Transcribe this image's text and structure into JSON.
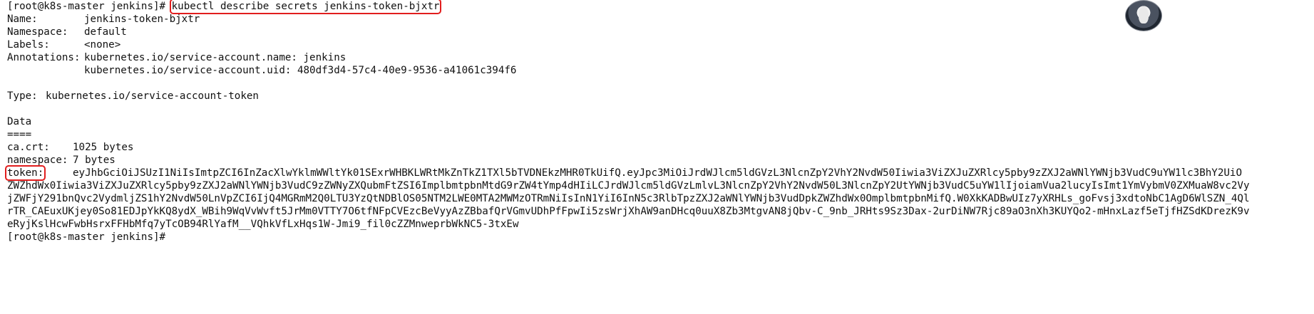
{
  "terminal": {
    "prompt": "[root@k8s-master jenkins]#",
    "command": "kubectl describe secrets jenkins-token-bjxtr",
    "name_label": "Name:",
    "name_value": "jenkins-token-bjxtr",
    "namespace_label": "Namespace:",
    "namespace_value": "default",
    "labels_label": "Labels:",
    "labels_value": "<none>",
    "annotations_label": "Annotations:",
    "annotation_1": "kubernetes.io/service-account.name: jenkins",
    "annotation_2": "kubernetes.io/service-account.uid: 480df3d4-57c4-40e9-9536-a41061c394f6",
    "type_label": "Type:",
    "type_value": "kubernetes.io/service-account-token",
    "data_header": "Data",
    "data_rule": "====",
    "cacrt_label": "ca.crt:",
    "cacrt_value": "1025 bytes",
    "ns_label": "namespace:",
    "ns_value": "7 bytes",
    "token_label": "token:",
    "token_line_1": "eyJhbGciOiJSUzI1NiIsImtpZCI6InZacXlwYklmWWltYk01SExrWHBKLWRtMkZnTkZ1TXl5bTVDNEkzMHR0TkUifQ.eyJpc3MiOiJrdWJlcm5ldGVzL3NlcnZpY2VhY2NvdW50Iiwia3ViZXJuZXRlcy5pby9zZXJ2aWNlYWNjb3VudC9uYW1lc3BhY2UiO",
    "token_line_2": "ZWZhdWx0Iiwia3ViZXJuZXRlcy5pby9zZXJ2aWNlYWNjb3VudC9zZWNyZXQubmFtZSI6ImplbmtpbnMtdG9rZW4tYmp4dHIiLCJrdWJlcm5ldGVzLmlvL3NlcnZpY2VhY2NvdW50L3NlcnZpY2UtYWNjb3VudC5uYW1lIjoiamVua2lucyIsImt1YmVybmV0ZXMuaW8vc2Vy",
    "token_line_3": "jZWFjY291bnQvc2VydmljZS1hY2NvdW50LnVpZCI6IjQ4MGRmM2Q0LTU3YzQtNDBlOS05NTM2LWE0MTA2MWMzOTRmNiIsInN1YiI6InN5c3RlbTpzZXJ2aWNlYWNjb3VudDpkZWZhdWx0OmplbmtpbnMifQ.W0XkKADBwUIz7yXRHLs_goFvsj3xdtoNbC1AgD6WlSZN_4Ql",
    "token_line_4": "rTR_CAEuxUKjey0So81EDJpYkKQ8ydX_WBih9WqVvWvft5JrMm0VTTY7O6tfNFpCVEzcBeVyyAzZBbafQrVGmvUDhPfFpwIi5zsWrjXhAW9anDHcq0uuX8Zb3MtgvAN8jQbv-C_9nb_JRHts9Sz3Dax-2urDiNW7Rjc89aO3nXh3KUYQo2-mHnxLazf5eTjfHZSdKDrezK9v",
    "token_line_5": "eRyjKslHcwFwbHsrxFFHbMfq7yTcOB94RlYafM__VQhkVfLxHqs1W-Jmi9_fil0cZZMnweprbWkNC5-3txEw",
    "prompt_end": "[root@k8s-master jenkins]#"
  },
  "avatar": {
    "icon": "user-avatar-icon"
  },
  "colors": {
    "highlight": "#e11d1d",
    "background": "#ffffff",
    "text": "#111111"
  }
}
